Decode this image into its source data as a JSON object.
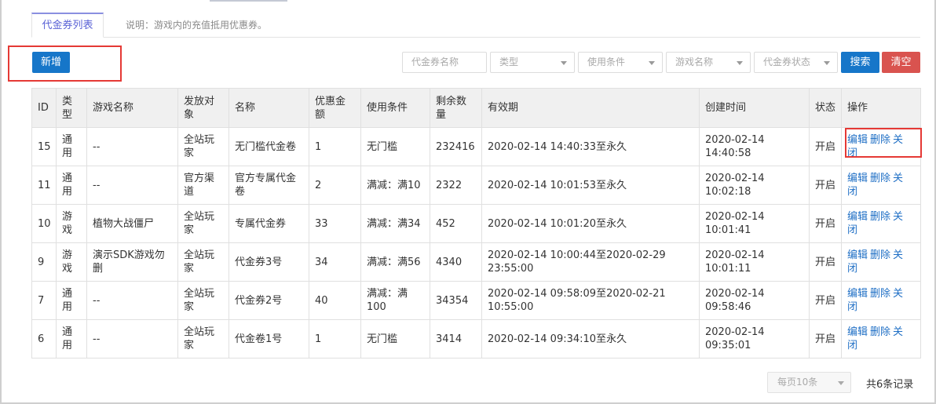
{
  "tabs": {
    "active_label": "代金券列表",
    "description": "说明：游戏内的充值抵用优惠券。"
  },
  "toolbar": {
    "add_label": "新增",
    "search_label": "搜索",
    "clear_label": "清空",
    "filters": {
      "name_placeholder": "代金券名称",
      "type": "类型",
      "condition": "使用条件",
      "game": "游戏名称",
      "status": "代金券状态"
    }
  },
  "accent_colors": {
    "primary": "#1676c9",
    "danger": "#d9534f",
    "highlight": "#e53935",
    "link": "#1f6fc5"
  },
  "table": {
    "headers": [
      "ID",
      "类型",
      "游戏名称",
      "发放对象",
      "名称",
      "优惠金额",
      "使用条件",
      "剩余数量",
      "有效期",
      "创建时间",
      "状态",
      "操作"
    ],
    "rows": [
      [
        "15",
        "通用",
        "--",
        "全站玩家",
        "无门槛代金卷",
        "1",
        "无门槛",
        "232416",
        "2020-02-14 14:40:33至永久",
        "2020-02-14 14:40:58",
        "开启"
      ],
      [
        "11",
        "通用",
        "--",
        "官方渠道",
        "官方专属代金卷",
        "2",
        "满减：满10",
        "2322",
        "2020-02-14 10:01:53至永久",
        "2020-02-14 10:02:18",
        "开启"
      ],
      [
        "10",
        "游戏",
        "植物大战僵尸",
        "全站玩家",
        "专属代金券",
        "33",
        "满减：满34",
        "452",
        "2020-02-14 10:01:20至永久",
        "2020-02-14 10:01:41",
        "开启"
      ],
      [
        "9",
        "游戏",
        "演示SDK游戏勿删",
        "全站玩家",
        "代金券3号",
        "34",
        "满减：满56",
        "4340",
        "2020-02-14 10:00:44至2020-02-29 23:55:00",
        "2020-02-14 10:01:11",
        "开启"
      ],
      [
        "7",
        "通用",
        "--",
        "全站玩家",
        "代金券2号",
        "40",
        "满减：满100",
        "34354",
        "2020-02-14 09:58:09至2020-02-21 10:55:00",
        "2020-02-14 09:58:46",
        "开启"
      ],
      [
        "6",
        "通用",
        "--",
        "全站玩家",
        "代金卷1号",
        "1",
        "无门槛",
        "3414",
        "2020-02-14 09:34:10至永久",
        "2020-02-14 09:35:01",
        "开启"
      ]
    ],
    "actions": {
      "edit": "编辑",
      "delete": "删除",
      "close": "关闭"
    }
  },
  "footer": {
    "page_size": "每页10条",
    "total": "共6条记录"
  }
}
